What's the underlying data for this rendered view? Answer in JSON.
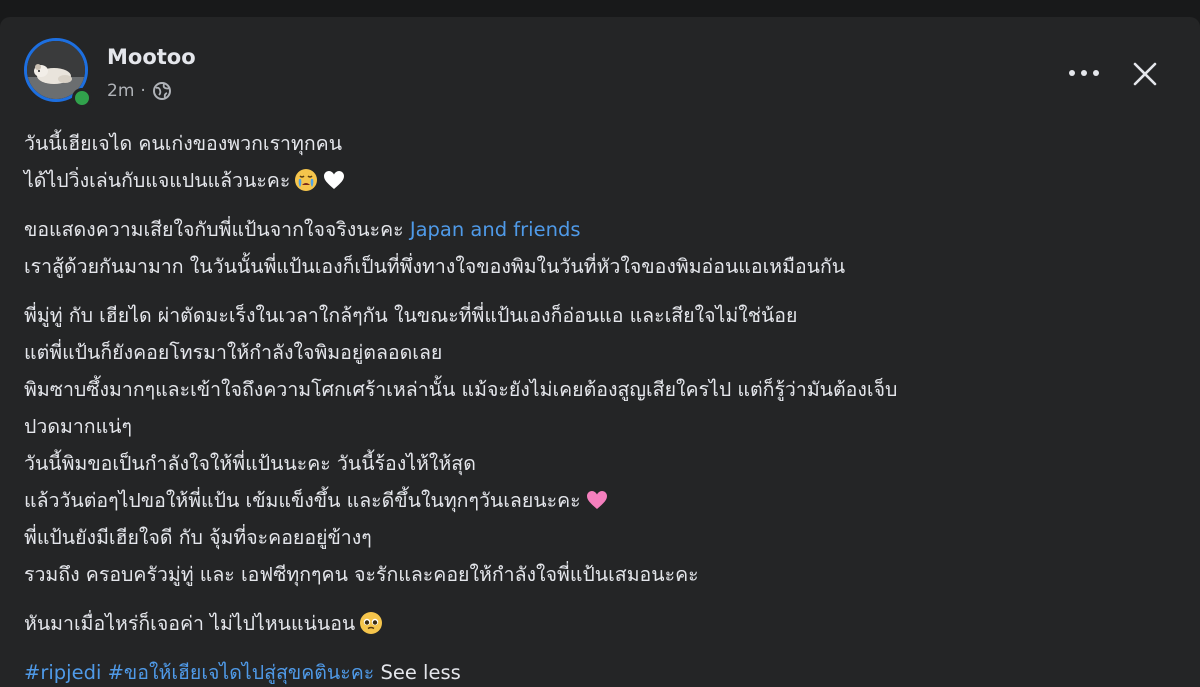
{
  "post": {
    "author": "Mootoo",
    "time": "2m",
    "separator": "·",
    "privacy_icon": "globe-icon",
    "more_icon": "more-horizontal-icon",
    "close_icon": "close-icon",
    "online": true
  },
  "paragraphs": {
    "p1": [
      "วันนี้เฮียเจได คนเก่งของพวกเราทุกคน",
      "ได้ไปวิ่งเล่นกับแจแปนแล้วนะคะ"
    ],
    "p2_l1_text": "ขอแสดงความเสียใจกับพี่แป้นจากใจจริงนะคะ ",
    "p2_l1_link": "Japan and friends",
    "p2_l2": "เราสู้ด้วยกันมามาก ในวันนั้นพี่แป้นเองก็เป็นที่พึ่งทางใจของพิมในวันที่หัวใจของพิมอ่อนแอเหมือนกัน",
    "p3": [
      "พี่มู่ทู่ กับ เฮียได ผ่าตัดมะเร็งในเวลาใกล้ๆกัน ในขณะที่พี่แป้นเองก็อ่อนแอ และเสียใจไม่ใช่น้อย",
      "แต่พี่แป้นก็ยังคอยโทรมาให้กำลังใจพิมอยู่ตลอดเลย",
      "พิมซาบซึ้งมากๆและเข้าใจถึงความโศกเศร้าเหล่านั้น แม้จะยังไม่เคยต้องสูญเสียใครไป แต่ก็รู้ว่ามันต้องเจ็บ",
      "ปวดมากแน่ๆ",
      "วันนี้พิมขอเป็นกำลังใจให้พี่แป้นนะคะ วันนี้ร้องไห้ให้สุด",
      "แล้ววันต่อๆไปขอให้พี่แป้น เข้มแข็งขึ้น และดีขึ้นในทุกๆวันเลยนะคะ",
      "พี่แป้นยังมีเฮียใจดี กับ จุ้มที่จะคอยอยู่ข้างๆ",
      "รวมถึง ครอบครัวมู่ทู่ และ เอฟซีทุกๆคน จะรักและคอยให้กำลังใจพี่แป้นเสมอนะคะ"
    ],
    "p4": "หันมาเมื่อไหร่ก็เจอค่า ไม่ไปไหนแน่นอน",
    "hashtags": [
      "#ripjedi",
      "#ขอให้เฮียเจไดไปสู่สุขคตินะคะ"
    ],
    "see_less": "See less"
  },
  "emojis": {
    "crying_face": "crying-face-icon",
    "white_heart": "white-heart-icon",
    "pink_heart": "pink-heart-icon",
    "pleading_face": "pleading-face-icon"
  },
  "colors": {
    "background": "#18191a",
    "card": "#242526",
    "text": "#e4e6eb",
    "secondary_text": "#b0b3b8",
    "link": "#4f9ae8",
    "online": "#31a24c",
    "avatar_ring": "#1d6fe0"
  }
}
